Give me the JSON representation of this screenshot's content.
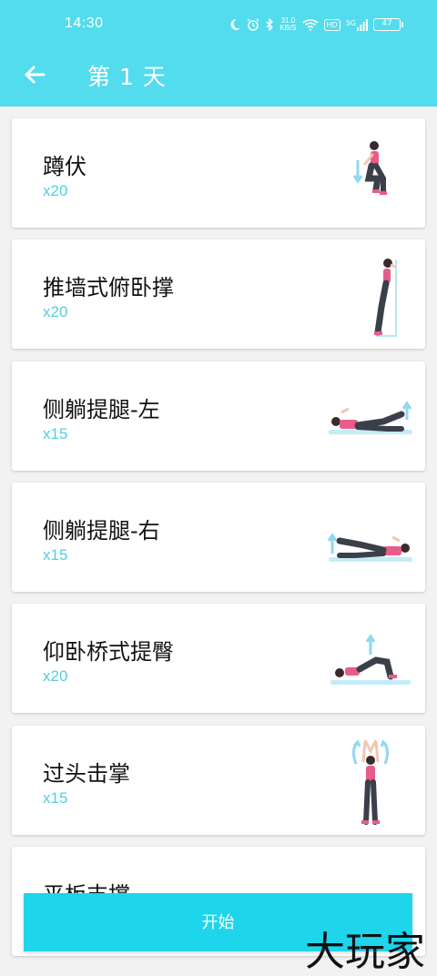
{
  "status_bar": {
    "time": "14:30",
    "net_speed_value": "31.0",
    "net_speed_unit": "KB/S",
    "hd": "HD",
    "signal": "5G",
    "battery": "47"
  },
  "nav": {
    "title": "第 1 天"
  },
  "exercises": [
    {
      "name": "蹲伏",
      "reps": "x20"
    },
    {
      "name": "推墙式俯卧撑",
      "reps": "x20"
    },
    {
      "name": "侧躺提腿-左",
      "reps": "x15"
    },
    {
      "name": "侧躺提腿-右",
      "reps": "x15"
    },
    {
      "name": "仰卧桥式提臀",
      "reps": "x20"
    },
    {
      "name": "过头击掌",
      "reps": "x15"
    },
    {
      "name": "平板支撑",
      "reps": ""
    }
  ],
  "start_button": {
    "label": "开始"
  },
  "watermark": {
    "text": "大玩家"
  },
  "colors": {
    "accent": "#52dced",
    "button": "#1ed5ec",
    "reps": "#52cfe0",
    "figure_top": "#e85b8a",
    "figure_pants": "#3b3f4a"
  }
}
